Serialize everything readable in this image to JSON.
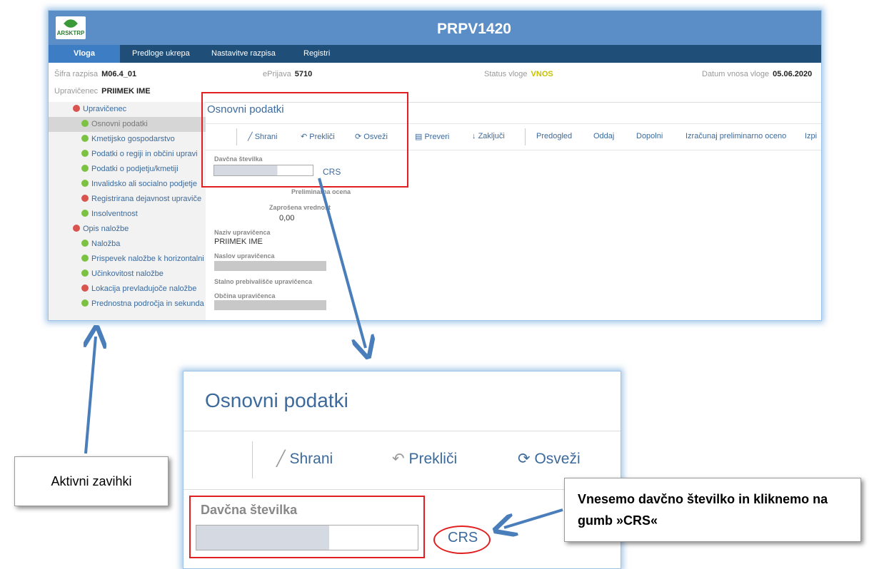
{
  "app": {
    "logo_text": "ARSKTRP",
    "title": "PRPV1420"
  },
  "nav": {
    "items": [
      "Vloga",
      "Predloge ukrepa",
      "Nastavitve razpisa",
      "Registri"
    ]
  },
  "info": {
    "sifra_label": "Šifra razpisa",
    "sifra_value": "M06.4_01",
    "eprijava_label": "ePrijava",
    "eprijava_value": "5710",
    "status_label": "Status vloge",
    "status_value": "VNOS",
    "datum_label": "Datum vnosa vloge",
    "datum_value": "05.06.2020",
    "upravicenec_label": "Upravičenec",
    "upravicenec_value": "PRIIMEK IME"
  },
  "sidebar": {
    "items": [
      {
        "label": "Upravičenec",
        "status": "red"
      },
      {
        "label": "Osnovni podatki",
        "status": "green"
      },
      {
        "label": "Kmetijsko gospodarstvo",
        "status": "green"
      },
      {
        "label": "Podatki o regiji in občini upravi",
        "status": "green"
      },
      {
        "label": "Podatki o podjetju/kmetiji",
        "status": "green"
      },
      {
        "label": "Invalidsko ali socialno podjetje",
        "status": "green"
      },
      {
        "label": "Registrirana dejavnost upraviče",
        "status": "red"
      },
      {
        "label": "Insolventnost",
        "status": "green"
      },
      {
        "label": "Opis naložbe",
        "status": "red"
      },
      {
        "label": "Naložba",
        "status": "green"
      },
      {
        "label": "Prispevek naložbe k horizontalni",
        "status": "green"
      },
      {
        "label": "Učinkovitost naložbe",
        "status": "green"
      },
      {
        "label": "Lokacija prevladujoče naložbe",
        "status": "red"
      },
      {
        "label": "Prednostna področja in sekunda",
        "status": "green"
      }
    ]
  },
  "content": {
    "title": "Osnovni podatki",
    "toolbar": [
      "Shrani",
      "Prekliči",
      "Osveži",
      "Preveri",
      "Zaključi",
      "Predogled",
      "Oddaj",
      "Dopolni",
      "Izračunaj preliminarno oceno",
      "Izpi"
    ],
    "davcna_label": "Davčna številka",
    "crs_label": "CRS",
    "preliminarna_label": "Preliminarna ocena",
    "zaprosena_label": "Zaprošena vrednost",
    "zaprosena_value": "0,00",
    "naziv_label": "Naziv upravičenca",
    "naziv_value": "PRIIMEK IME",
    "naslov_label": "Naslov upravičenca",
    "prebivalisce_label": "Stalno prebivališče upravičenca",
    "obcina_label": "Občina upravičenca"
  },
  "zoom": {
    "title": "Osnovni podatki",
    "shrani": "Shrani",
    "preklici": "Prekliči",
    "osvezi": "Osveži",
    "davcna_label": "Davčna številka",
    "crs_label": "CRS"
  },
  "callouts": {
    "left": "Aktivni zavihki",
    "right": "Vnesemo davčno številko in kliknemo na gumb »CRS«"
  },
  "colors": {
    "topbar": "#5b8ec6",
    "navbar": "#1f4e79",
    "nav_active": "#3c7dc4",
    "status_red": "#d9534f",
    "status_green": "#7cc242",
    "annotation_red": "#e02020",
    "arrow_blue": "#4a7ebb"
  }
}
